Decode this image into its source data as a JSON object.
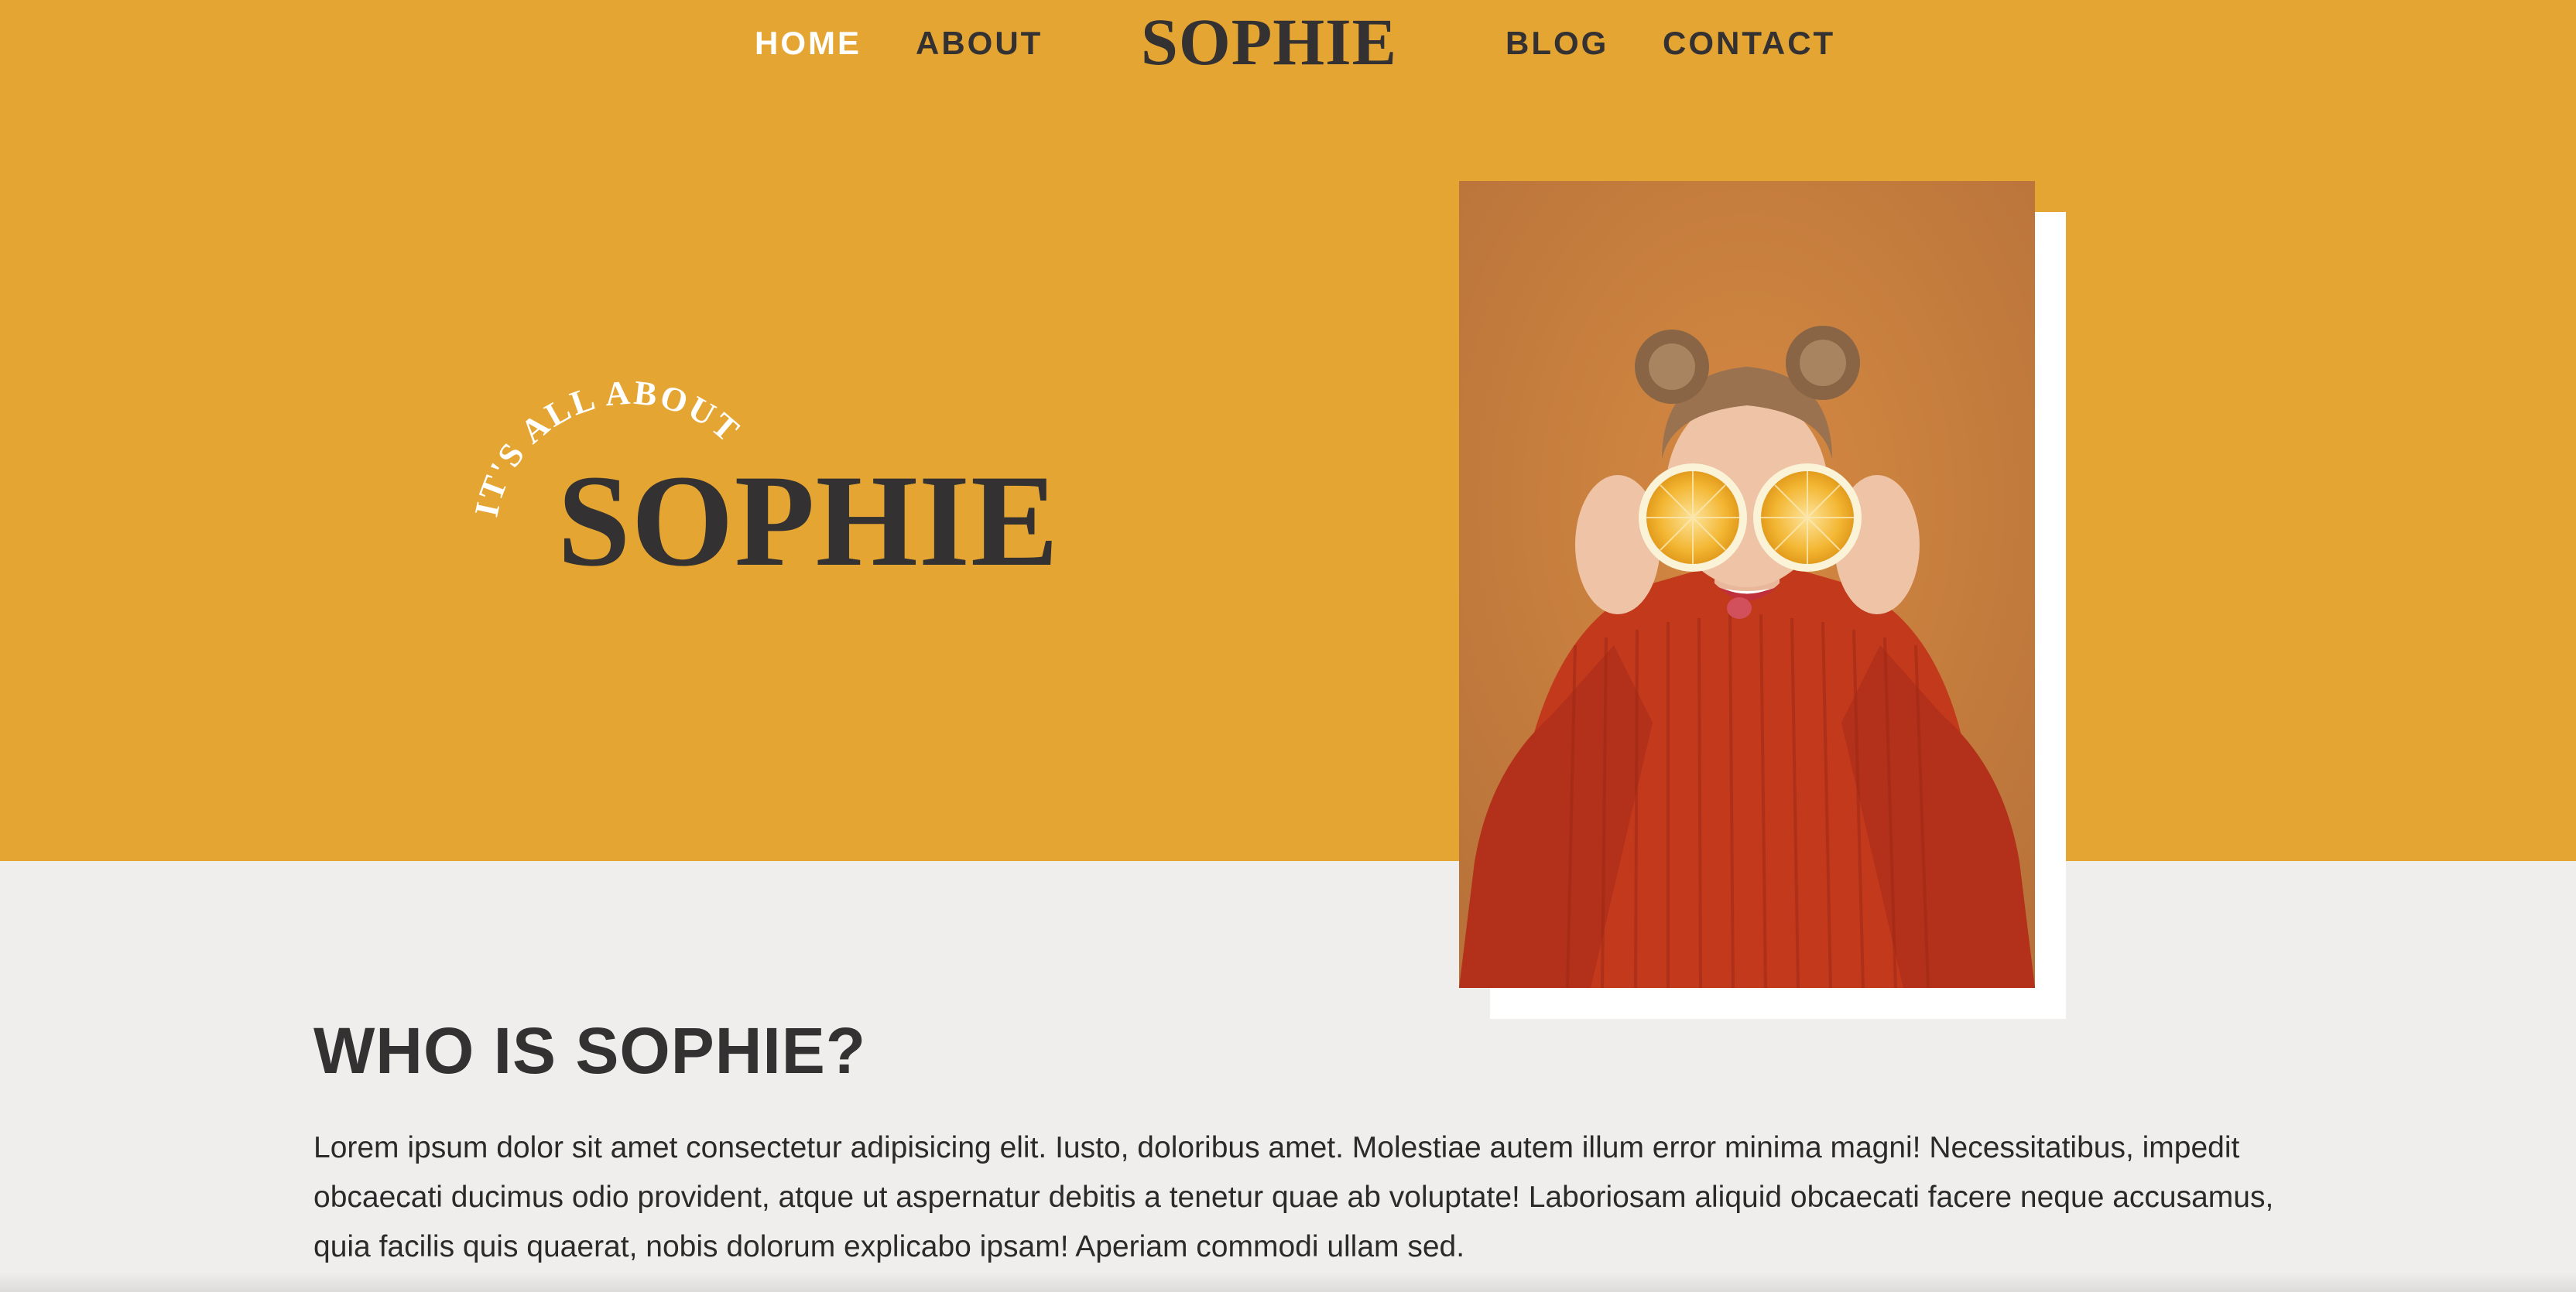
{
  "nav": {
    "home": "HOME",
    "about": "ABOUT",
    "logo": "SOPHIE",
    "blog": "BLOG",
    "contact": "CONTACT"
  },
  "hero": {
    "arc_text": "IT'S ALL ABOUT",
    "name": "SOPHIE",
    "photo_alt": "Woman in red sweater holding orange halves over her eyes"
  },
  "about": {
    "heading": "WHO IS SOPHIE?",
    "body": "Lorem ipsum dolor sit amet consectetur adipisicing elit. Iusto, doloribus amet. Molestiae autem illum error minima magni! Necessitatibus, impedit obcaecati ducimus odio provident, atque ut aspernatur debitis a tenetur quae ab voluptate! Laboriosam aliquid obcaecati facere neque accusamus, quia facilis quis quaerat, nobis dolorum explicabo ipsam! Aperiam commodi ullam sed."
  },
  "colors": {
    "hero_background": "#e4a533",
    "page_background": "#efeeec",
    "text_dark": "#333131",
    "nav_active": "#ffffff"
  },
  "icons": {
    "photo": "portrait-photo"
  }
}
